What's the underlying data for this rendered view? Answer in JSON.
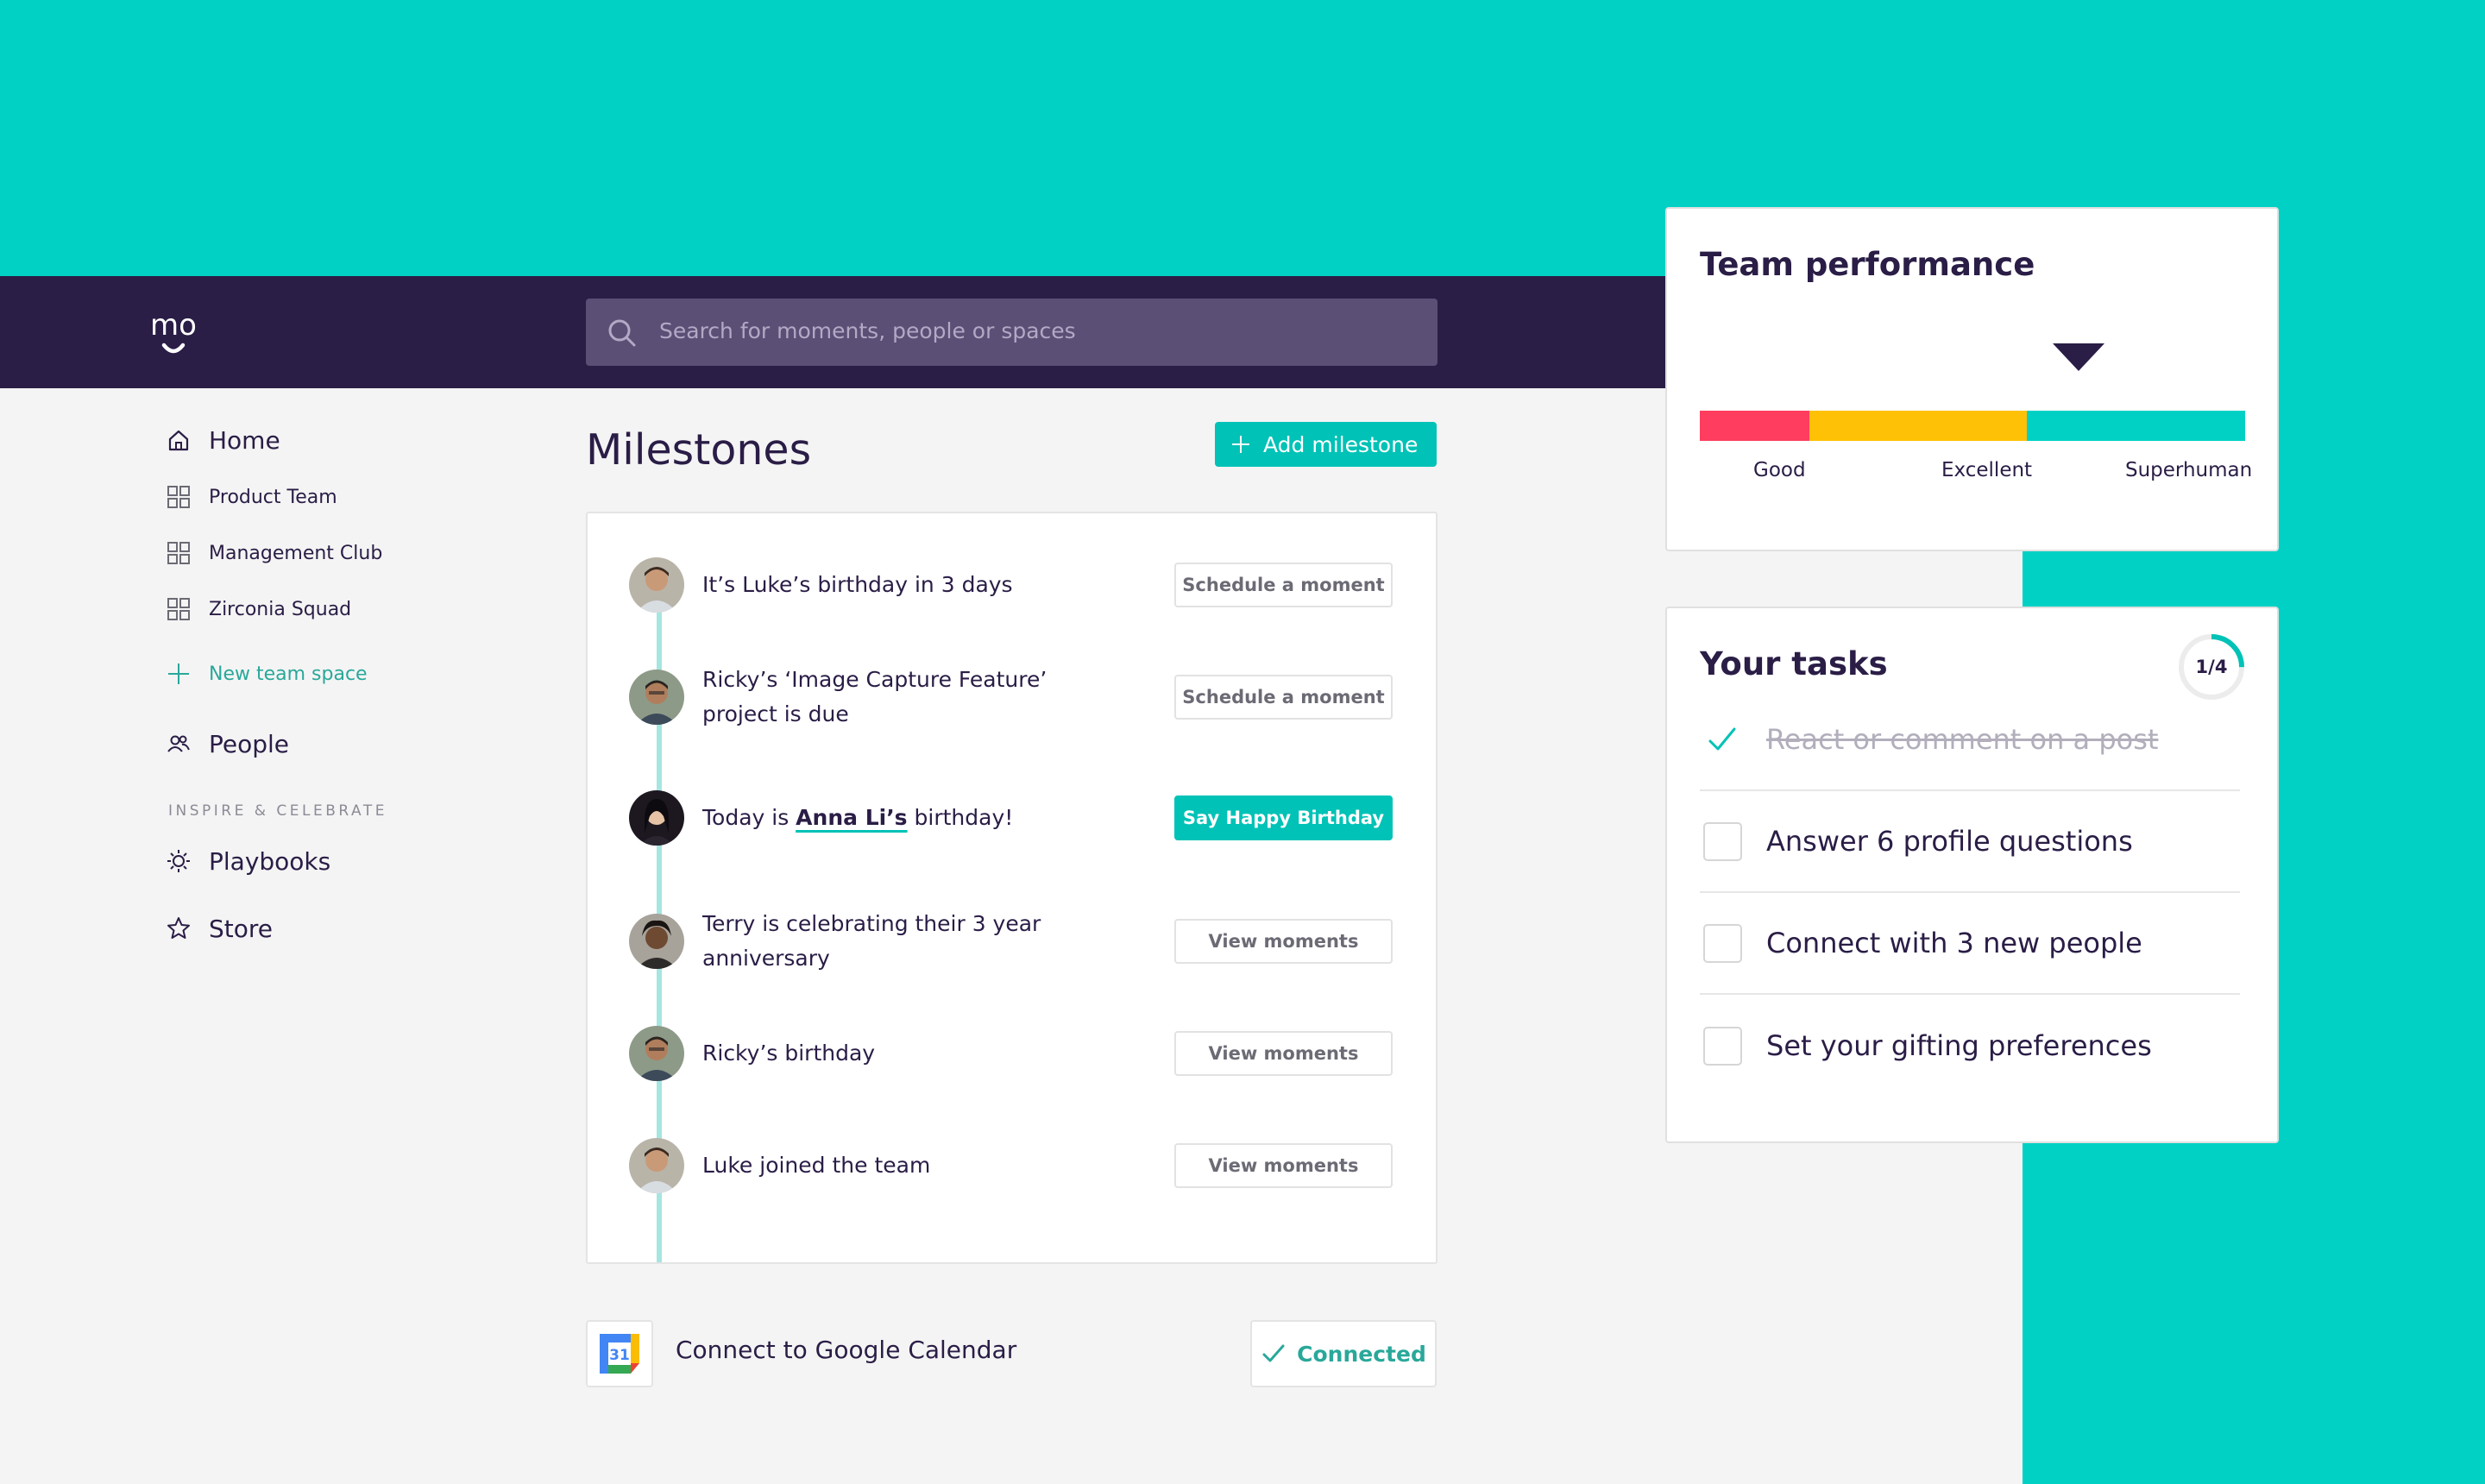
{
  "header": {
    "logo_text": "mo",
    "search_placeholder": "Search for moments, people or spaces"
  },
  "sidebar": {
    "home": "Home",
    "spaces": [
      "Product Team",
      "Management Club",
      "Zirconia Squad"
    ],
    "new_space": "New team space",
    "people": "People",
    "section_label": "INSPIRE & CELEBRATE",
    "playbooks": "Playbooks",
    "store": "Store"
  },
  "milestones": {
    "title": "Milestones",
    "add_label": "Add milestone",
    "items": [
      {
        "text": "It’s Luke’s birthday in 3 days",
        "action": "Schedule a moment",
        "primary": false
      },
      {
        "text": "Ricky’s ‘Image Capture Feature’ project is due",
        "action": "Schedule a moment",
        "primary": false
      },
      {
        "text_pre": "Today is ",
        "text_bold": "Anna Li’s",
        "text_post": " birthday!",
        "action": "Say Happy Birthday",
        "primary": true
      },
      {
        "text": "Terry is celebrating their 3 year anniversary",
        "action": "View moments",
        "primary": false
      },
      {
        "text": "Ricky’s birthday",
        "action": "View moments",
        "primary": false
      },
      {
        "text": "Luke joined the team",
        "action": "View moments",
        "primary": false
      }
    ]
  },
  "calendar": {
    "icon_day": "31",
    "text": "Connect to Google Calendar",
    "status": "Connected"
  },
  "performance": {
    "title": "Team performance",
    "labels": [
      "Good",
      "Excellent",
      "Superhuman"
    ],
    "colors": [
      "#ff3d5f",
      "#ffc105",
      "#00d1c4"
    ],
    "marker_level": 0.69
  },
  "tasks": {
    "title": "Your tasks",
    "progress": "1/4",
    "progress_fraction": 0.25,
    "items": [
      {
        "label": "React or comment on a post",
        "done": true
      },
      {
        "label": "Answer 6 profile questions",
        "done": false
      },
      {
        "label": "Connect with 3 new people",
        "done": false
      },
      {
        "label": "Set your gifting preferences",
        "done": false
      }
    ]
  }
}
